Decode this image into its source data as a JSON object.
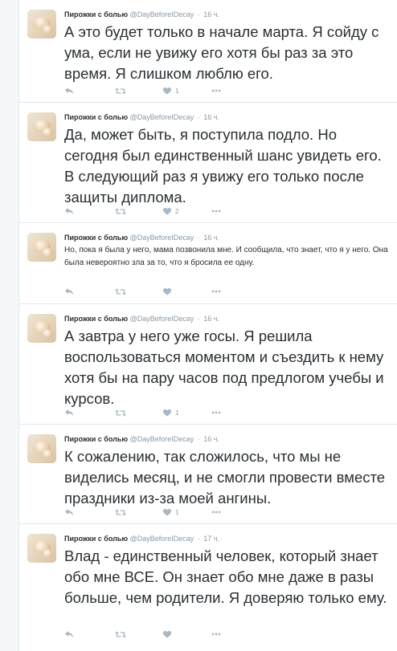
{
  "tweets": [
    {
      "name": "Пирожки с болью",
      "handle": "@DayBeforeIDecay",
      "time": "16 ч.",
      "text": "А это будет только в начале марта. Я сойду с ума, если не увижу его хотя бы раз за это время. Я слишком люблю его.",
      "likes": "1"
    },
    {
      "name": "Пирожки с болью",
      "handle": "@DayBeforeIDecay",
      "time": "16 ч.",
      "text": "Да, может быть, я поступила подло. Но сегодня был единственный шанс увидеть его. В следующий раз я увижу его только после защиты диплома.",
      "likes": "2"
    },
    {
      "name": "Пирожки с болью",
      "handle": "@DayBeforeIDecay",
      "time": "16 ч.",
      "text": "Но, пока я была у него, мама позвонила мне. И сообщила, что знает, что я у него. Она была невероятно зла за то, что я бросила ее одну.",
      "likes": ""
    },
    {
      "name": "Пирожки с болью",
      "handle": "@DayBeforeIDecay",
      "time": "16 ч.",
      "text": "А завтра у него уже госы. Я решила воспользоваться моментом и съездить к нему хотя бы на пару часов под предлогом учебы и курсов.",
      "likes": "1"
    },
    {
      "name": "Пирожки с болью",
      "handle": "@DayBeforeIDecay",
      "time": "16 ч.",
      "text": "К сожалению, так сложилось, что мы не виделись месяц, и не смогли провести вместе праздники из-за моей ангины.",
      "likes": "1"
    },
    {
      "name": "Пирожки с болью",
      "handle": "@DayBeforeIDecay",
      "time": "17 ч.",
      "text": "Влад - единственный человек, который знает обо мне ВСЕ. Он знает обо мне даже в разы больше, чем родители. Я доверяю только ему.",
      "likes": ""
    }
  ],
  "separator": "·",
  "icons": {
    "reply": "reply-icon",
    "retweet": "retweet-icon",
    "like": "heart-icon",
    "more": "more-icon"
  },
  "colors": {
    "text": "#292f33",
    "meta": "#8899a6",
    "icon": "#aab8c2",
    "border": "#e1e8ed"
  }
}
